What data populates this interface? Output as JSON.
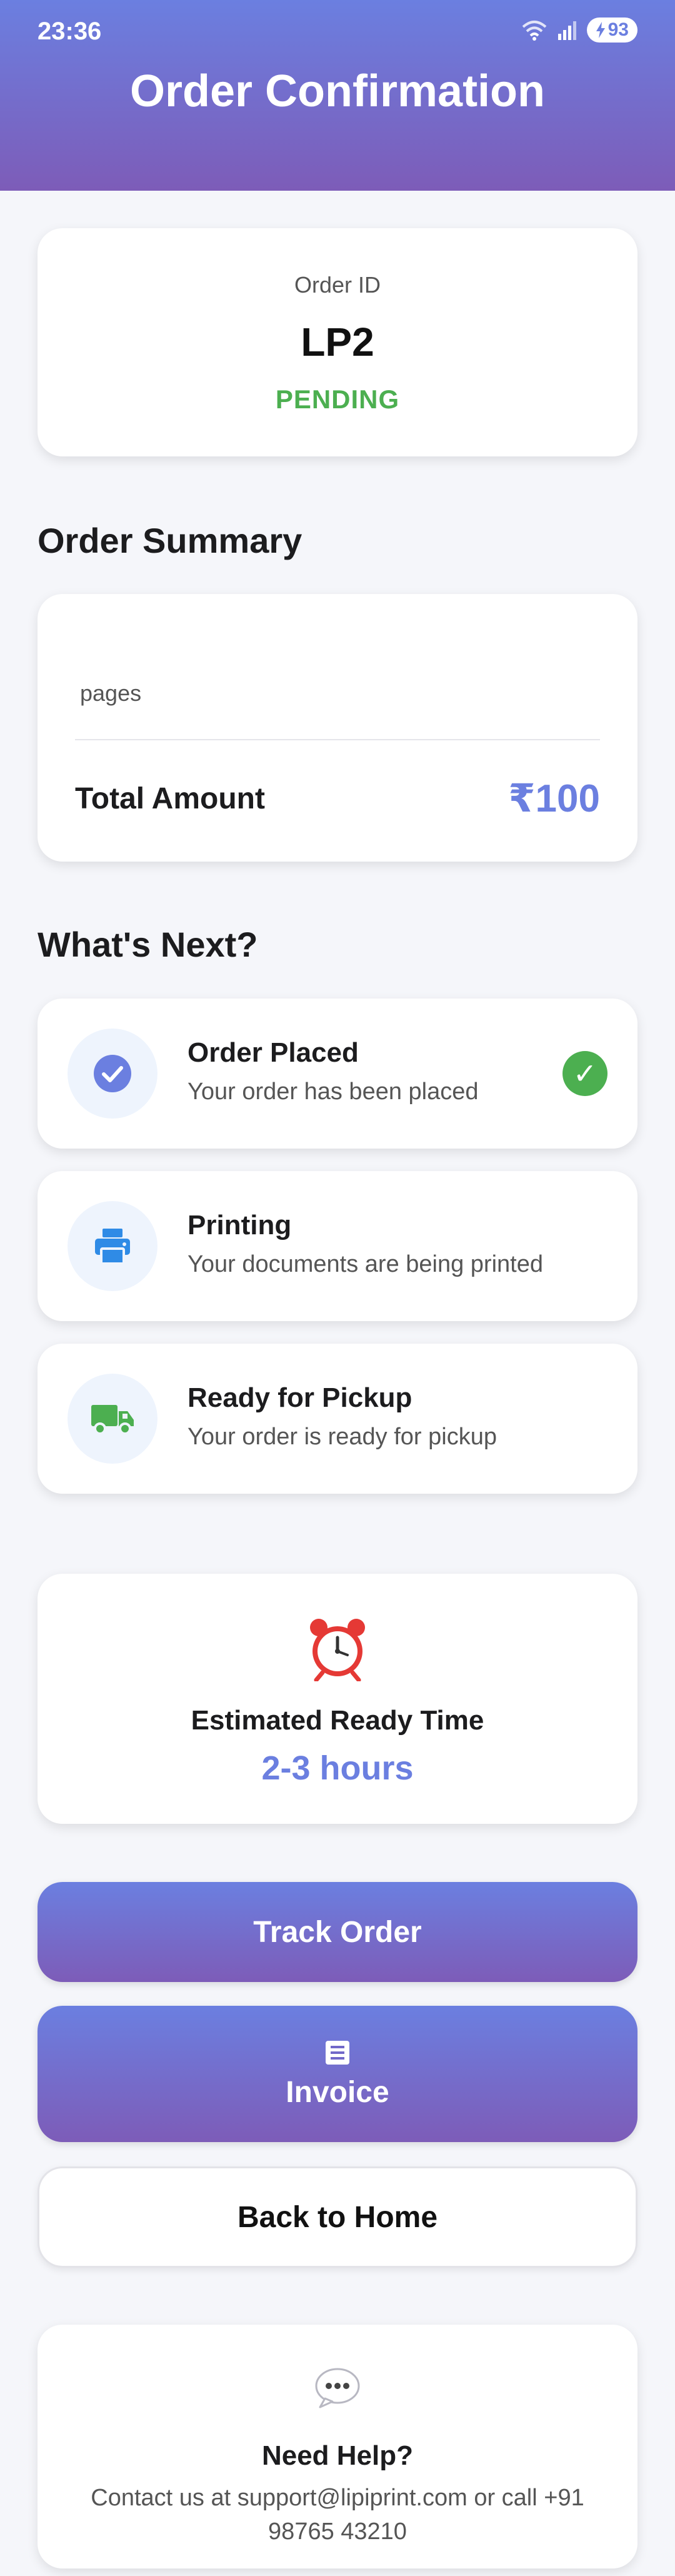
{
  "status_bar": {
    "time": "23:36",
    "battery": "93",
    "icons": [
      "wifi-icon",
      "signal-icon",
      "battery-charging-icon"
    ]
  },
  "header": {
    "title": "Order Confirmation"
  },
  "order": {
    "id_label": "Order ID",
    "id": "LP2",
    "status": "PENDING"
  },
  "summary": {
    "title": "Order Summary",
    "pages_label": "pages",
    "total_label": "Total Amount",
    "total_value": "₹100"
  },
  "next": {
    "title": "What's Next?",
    "steps": [
      {
        "title": "Order Placed",
        "description": "Your order has been placed",
        "icon": "check-circle-icon",
        "completed": true
      },
      {
        "title": "Printing",
        "description": "Your documents are being printed",
        "icon": "printer-icon",
        "completed": false
      },
      {
        "title": "Ready for Pickup",
        "description": "Your order is ready for pickup",
        "icon": "truck-icon",
        "completed": false
      }
    ]
  },
  "eta": {
    "icon": "alarm-clock-icon",
    "label": "Estimated Ready Time",
    "value": "2-3 hours"
  },
  "buttons": {
    "track": "Track Order",
    "invoice": "Invoice",
    "home": "Back to Home"
  },
  "help": {
    "icon": "speech-bubble-icon",
    "title": "Need Help?",
    "text": "Contact us at support@lipiprint.com or call +91 98765 43210"
  },
  "colors": {
    "accent": "#6b7fe0",
    "gradient_end": "#7d5cb8",
    "success": "#4caf50",
    "printer_blue": "#2f8be6",
    "truck_green": "#4caf50"
  }
}
